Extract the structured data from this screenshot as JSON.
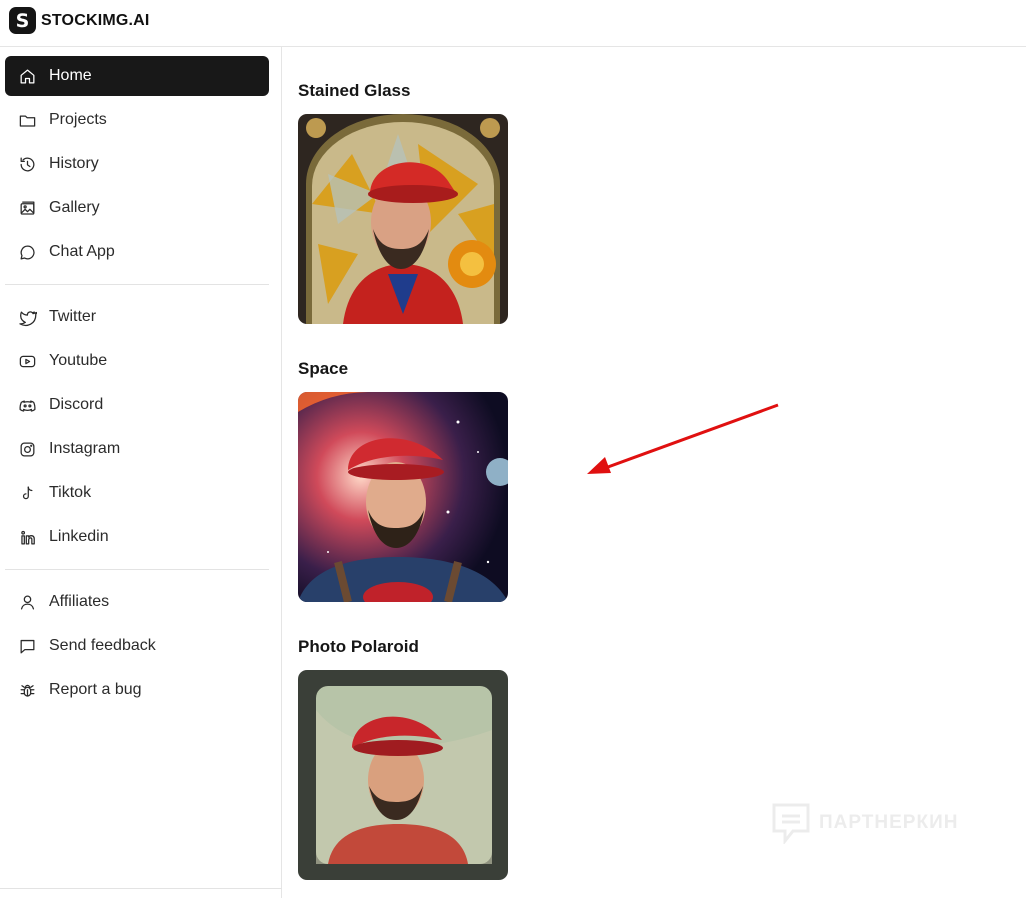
{
  "header": {
    "logo_letter": "S",
    "brand": "STOCKIMG.AI"
  },
  "sidebar": {
    "primary": [
      {
        "label": "Home",
        "icon": "home-icon",
        "active": true
      },
      {
        "label": "Projects",
        "icon": "folder-icon"
      },
      {
        "label": "History",
        "icon": "history-icon"
      },
      {
        "label": "Gallery",
        "icon": "gallery-icon"
      },
      {
        "label": "Chat App",
        "icon": "chat-icon"
      }
    ],
    "social": [
      {
        "label": "Twitter",
        "icon": "twitter-icon"
      },
      {
        "label": "Youtube",
        "icon": "youtube-icon"
      },
      {
        "label": "Discord",
        "icon": "discord-icon"
      },
      {
        "label": "Instagram",
        "icon": "instagram-icon"
      },
      {
        "label": "Tiktok",
        "icon": "tiktok-icon"
      },
      {
        "label": "Linkedin",
        "icon": "linkedin-icon"
      }
    ],
    "support": [
      {
        "label": "Affiliates",
        "icon": "user-icon"
      },
      {
        "label": "Send feedback",
        "icon": "feedback-icon"
      },
      {
        "label": "Report a bug",
        "icon": "bug-icon"
      }
    ]
  },
  "main": {
    "styles": [
      {
        "title": "Stained Glass"
      },
      {
        "title": "Space"
      },
      {
        "title": "Photo Polaroid"
      }
    ]
  },
  "annotation": {
    "arrow_color": "#e01010"
  },
  "watermark": {
    "text": "ПАРТНЕРКИН"
  },
  "colors": {
    "active_bg": "#181818",
    "border": "#e5e5e5"
  }
}
